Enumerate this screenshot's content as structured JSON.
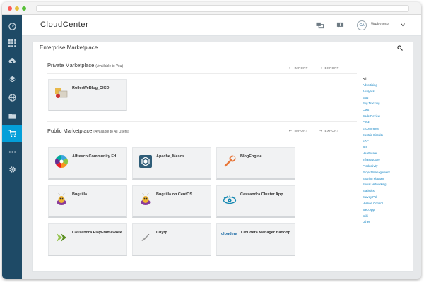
{
  "app": {
    "brand": "CloudCenter"
  },
  "header": {
    "avatar_initials": "CA",
    "welcome": "Welcome"
  },
  "panel": {
    "title": "Enterprise Marketplace"
  },
  "private": {
    "title": "Private Marketplace",
    "subtitle": "(Available to You)",
    "import_label": "IMPORT",
    "export_label": "EXPORT",
    "apps": [
      {
        "name": "RollerWeBlog_CICD",
        "icon": "rollerweblog-logo-icon"
      }
    ]
  },
  "public": {
    "title": "Public Marketplace",
    "subtitle": "(Available to All Users)",
    "import_label": "IMPORT",
    "export_label": "EXPORT",
    "apps": [
      {
        "name": "Alfresco Community Ed",
        "icon": "alfresco-logo-icon"
      },
      {
        "name": "Apache_Mesos",
        "icon": "mesos-logo-icon"
      },
      {
        "name": "BlogEngine",
        "icon": "blogengine-logo-icon"
      },
      {
        "name": "Bugzilla",
        "icon": "bugzilla-logo-icon"
      },
      {
        "name": "Bugzilla on CentOS",
        "icon": "bugzilla-logo-icon"
      },
      {
        "name": "Cassandra Cluster App",
        "icon": "cassandra-logo-icon"
      },
      {
        "name": "Cassandra PlayFramework",
        "icon": "playframework-logo-icon"
      },
      {
        "name": "Chyrp",
        "icon": "chyrp-logo-icon"
      },
      {
        "name": "Cloudera Manager Hadoop",
        "icon": "cloudera-logo-icon",
        "logo_text": "cloudera"
      }
    ]
  },
  "categories": [
    "All",
    "Advertising",
    "Analytics",
    "Blog",
    "Bug Tracking",
    "CMS",
    "Code Review",
    "CRM",
    "E-commerce",
    "Electric Circuits",
    "ERP",
    "GIS",
    "Healthcare",
    "Infrastructure",
    "Productivity",
    "Project Management",
    "Sharing Platform",
    "Social Networking",
    "Statistics",
    "Survey Poll",
    "Version Control",
    "Web App",
    "Wiki",
    "Other"
  ],
  "colors": {
    "nav_bg": "#1e4a66",
    "nav_active": "#049fd9",
    "link": "#0a7fc0"
  }
}
